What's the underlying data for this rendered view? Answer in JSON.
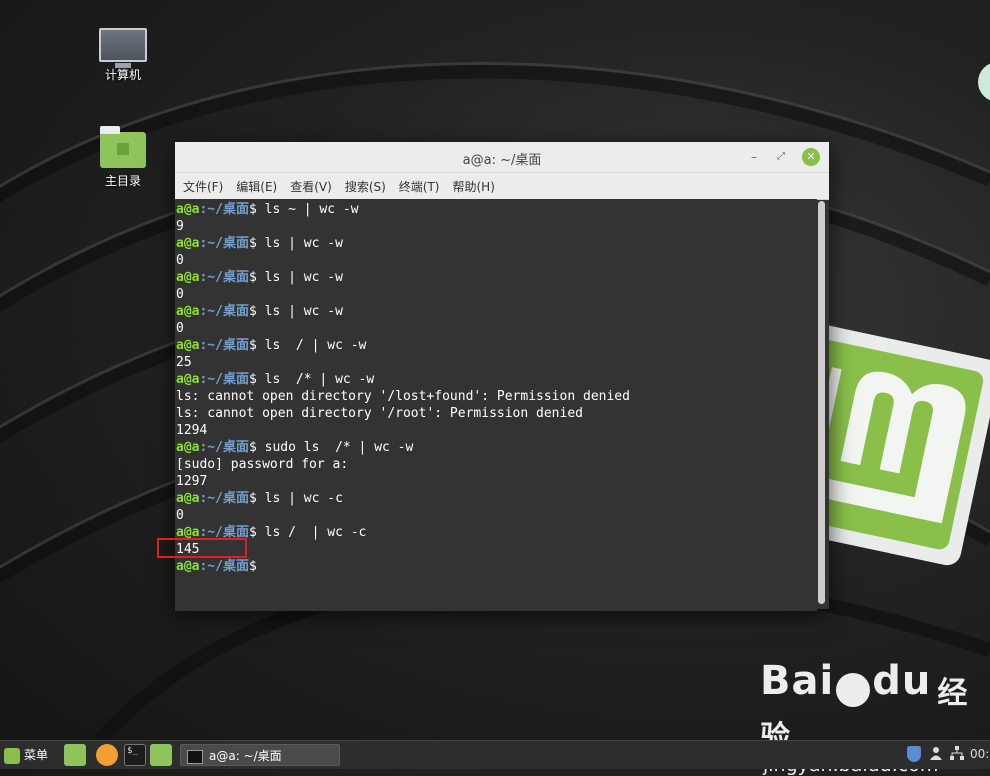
{
  "desktop": {
    "icons": [
      {
        "label": "计算机"
      },
      {
        "label": "主目录"
      }
    ]
  },
  "window": {
    "title": "a@a: ~/桌面",
    "menu": [
      "文件(F)",
      "编辑(E)",
      "查看(V)",
      "搜索(S)",
      "终端(T)",
      "帮助(H)"
    ]
  },
  "terminal": {
    "prompt_user": "a@a",
    "prompt_path": ":~/桌面",
    "prompt_symbol": "$",
    "lines": [
      {
        "type": "cmd",
        "text": " ls ~ | wc -w"
      },
      {
        "type": "out",
        "text": "9"
      },
      {
        "type": "cmd",
        "text": " ls | wc -w"
      },
      {
        "type": "out",
        "text": "0"
      },
      {
        "type": "cmd",
        "text": " ls | wc -w"
      },
      {
        "type": "out",
        "text": "0"
      },
      {
        "type": "cmd",
        "text": " ls | wc -w"
      },
      {
        "type": "out",
        "text": "0"
      },
      {
        "type": "cmd",
        "text": " ls  / | wc -w"
      },
      {
        "type": "out",
        "text": "25"
      },
      {
        "type": "cmd",
        "text": " ls  /* | wc -w"
      },
      {
        "type": "out",
        "text": "ls: cannot open directory '/lost+found': Permission denied"
      },
      {
        "type": "out",
        "text": "ls: cannot open directory '/root': Permission denied"
      },
      {
        "type": "out",
        "text": "1294"
      },
      {
        "type": "cmd",
        "text": " sudo ls  /* | wc -w"
      },
      {
        "type": "out",
        "text": "[sudo] password for a:"
      },
      {
        "type": "out",
        "text": "1297"
      },
      {
        "type": "cmd",
        "text": " ls | wc -c"
      },
      {
        "type": "out",
        "text": "0"
      },
      {
        "type": "cmd",
        "text": " ls /  | wc -c"
      },
      {
        "type": "out",
        "text": "145"
      },
      {
        "type": "cmd",
        "text": ""
      }
    ]
  },
  "watermark": {
    "brand_left": "Bai",
    "brand_right": "du",
    "brand_cn": "经验",
    "url": "jingyan.baidu.com"
  },
  "taskbar": {
    "menu_label": "菜单",
    "task_label": "a@a: ~/桌面",
    "clock": "00:"
  },
  "colors": {
    "prompt_user": "#8ae234",
    "prompt_path": "#729fcf",
    "accent_mint": "#8ac04a",
    "highlight_box": "#e02020"
  }
}
